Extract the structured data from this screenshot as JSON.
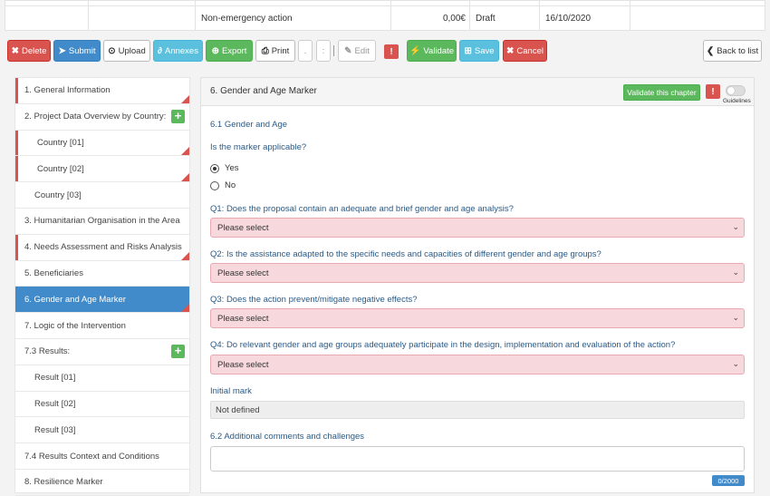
{
  "top_row": {
    "action_name": "Non-emergency action",
    "amount": "0,00€",
    "status": "Draft",
    "date": "16/10/2020"
  },
  "toolbar": {
    "delete": "Delete",
    "submit": "Submit",
    "upload": "Upload",
    "annexes": "Annexes",
    "export": "Export",
    "print": "Print",
    "edit": "Edit",
    "validate": "Validate",
    "save": "Save",
    "cancel": "Cancel",
    "back": "Back to list",
    "dot1": ".",
    "dot2": ":"
  },
  "sidebar": {
    "items": [
      {
        "label": "1. General Information"
      },
      {
        "label": "2. Project Data Overview by Country:"
      },
      {
        "label": "Country [01]"
      },
      {
        "label": "Country [02]"
      },
      {
        "label": "Country [03]"
      },
      {
        "label": "3. Humanitarian Organisation in the Area"
      },
      {
        "label": "4. Needs Assessment and Risks Analysis"
      },
      {
        "label": "5. Beneficiaries"
      },
      {
        "label": "6. Gender and Age Marker"
      },
      {
        "label": "7. Logic of the Intervention"
      },
      {
        "label": "7.3 Results:"
      },
      {
        "label": "Result [01]"
      },
      {
        "label": "Result [02]"
      },
      {
        "label": "Result [03]"
      },
      {
        "label": "7.4 Results Context and Conditions"
      },
      {
        "label": "8. Resilience Marker"
      }
    ]
  },
  "panel": {
    "title": "6. Gender and Age Marker",
    "validate_chapter": "Validate this chapter",
    "guidelines": "Guidelines",
    "section_1": "6.1 Gender and Age",
    "q_applicable": "Is the marker applicable?",
    "opt_yes": "Yes",
    "opt_no": "No",
    "q1": "Q1: Does the proposal contain an adequate and brief gender and age analysis?",
    "q2": "Q2: Is the assistance adapted to the specific needs and capacities of different gender and age groups?",
    "q3": "Q3: Does the action prevent/mitigate negative effects?",
    "q4": "Q4: Do relevant gender and age groups adequately participate in the design, implementation and evaluation of the action?",
    "select_placeholder": "Please select",
    "initial_mark_label": "Initial mark",
    "initial_mark_value": "Not defined",
    "section_2": "6.2 Additional comments and challenges",
    "counter": "0/2000"
  }
}
